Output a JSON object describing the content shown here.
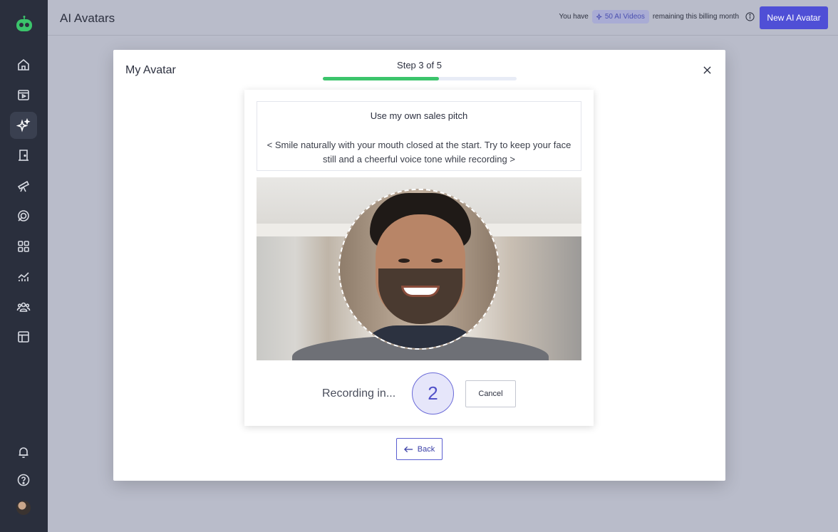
{
  "header": {
    "title": "AI Avatars",
    "quota_prefix": "You have",
    "quota_badge": "50 AI Videos",
    "quota_suffix": "remaining this billing month",
    "new_button": "New AI Avatar"
  },
  "sidebar": {
    "items": [
      {
        "icon": "home-icon"
      },
      {
        "icon": "video-library-icon"
      },
      {
        "icon": "sparkles-icon",
        "active": true
      },
      {
        "icon": "door-icon"
      },
      {
        "icon": "telescope-icon"
      },
      {
        "icon": "target-icon"
      },
      {
        "icon": "apps-grid-icon"
      },
      {
        "icon": "analytics-icon"
      },
      {
        "icon": "team-icon"
      },
      {
        "icon": "layout-icon"
      }
    ],
    "bottom": [
      {
        "icon": "bell-icon"
      },
      {
        "icon": "help-icon"
      }
    ]
  },
  "modal": {
    "title": "My Avatar",
    "step_label": "Step 3 of 5",
    "progress": 0.6,
    "prompt_title": "Use my own sales pitch",
    "prompt_text": "< Smile naturally with your mouth closed at the start. Try to keep your face still and a cheerful voice tone while recording >",
    "recording_label": "Recording in...",
    "countdown": "2",
    "cancel_label": "Cancel",
    "back_label": "Back"
  },
  "colors": {
    "accent": "#4f4fd6",
    "progress": "#3bc46b",
    "sidebar": "#2a2f3d"
  }
}
